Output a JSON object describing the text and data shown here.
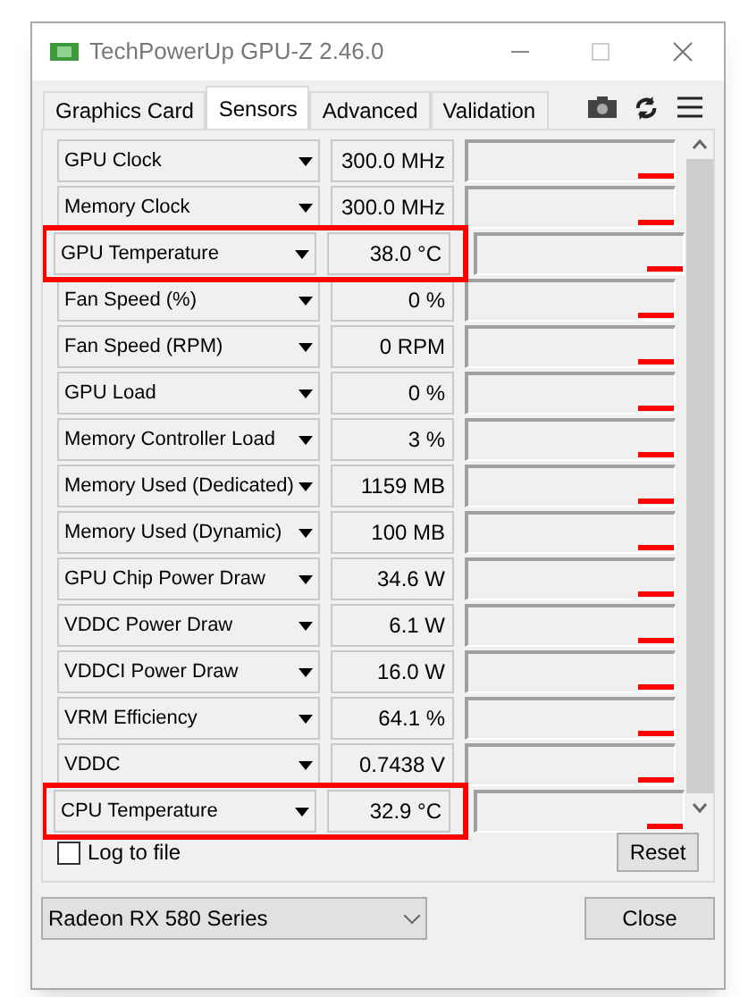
{
  "window": {
    "title": "TechPowerUp GPU-Z 2.46.0"
  },
  "tabs": [
    {
      "label": "Graphics Card",
      "selected": false
    },
    {
      "label": "Sensors",
      "selected": true
    },
    {
      "label": "Advanced",
      "selected": false
    },
    {
      "label": "Validation",
      "selected": false
    }
  ],
  "sensors": [
    {
      "name": "GPU Clock",
      "value": "300.0 MHz",
      "highlighted": false
    },
    {
      "name": "Memory Clock",
      "value": "300.0 MHz",
      "highlighted": false
    },
    {
      "name": "GPU Temperature",
      "value": "38.0 °C",
      "highlighted": true
    },
    {
      "name": "Fan Speed (%)",
      "value": "0 %",
      "highlighted": false
    },
    {
      "name": "Fan Speed (RPM)",
      "value": "0 RPM",
      "highlighted": false
    },
    {
      "name": "GPU Load",
      "value": "0 %",
      "highlighted": false
    },
    {
      "name": "Memory Controller Load",
      "value": "3 %",
      "highlighted": false
    },
    {
      "name": "Memory Used (Dedicated)",
      "value": "1159 MB",
      "highlighted": false
    },
    {
      "name": "Memory Used (Dynamic)",
      "value": "100 MB",
      "highlighted": false
    },
    {
      "name": "GPU Chip Power Draw",
      "value": "34.6 W",
      "highlighted": false
    },
    {
      "name": "VDDC Power Draw",
      "value": "6.1 W",
      "highlighted": false
    },
    {
      "name": "VDDCI Power Draw",
      "value": "16.0 W",
      "highlighted": false
    },
    {
      "name": "VRM Efficiency",
      "value": "64.1 %",
      "highlighted": false
    },
    {
      "name": "VDDC",
      "value": "0.7438 V",
      "highlighted": false
    },
    {
      "name": "CPU Temperature",
      "value": "32.9 °C",
      "highlighted": true
    }
  ],
  "log_to_file": {
    "label": "Log to file",
    "checked": false
  },
  "reset_button": "Reset",
  "gpu_select": {
    "value": "Radeon RX 580 Series"
  },
  "close_button": "Close"
}
